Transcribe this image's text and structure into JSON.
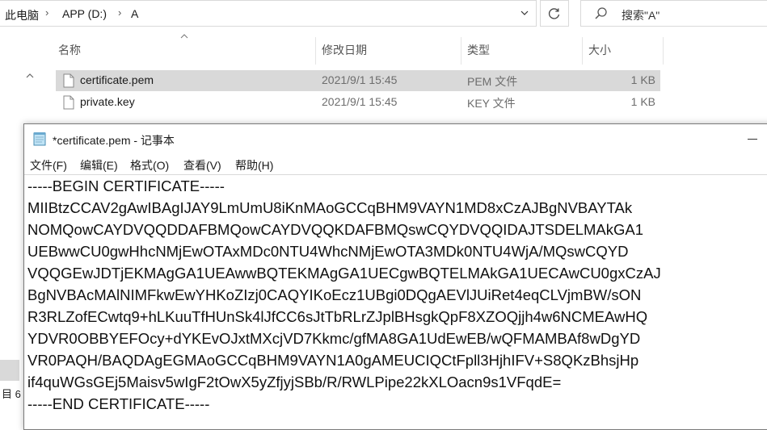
{
  "breadcrumb": {
    "items": [
      "此电脑",
      "APP (D:)",
      "A"
    ]
  },
  "search": {
    "placeholder": "搜索\"A\""
  },
  "columns": {
    "name": "名称",
    "modified": "修改日期",
    "type": "类型",
    "size": "大小"
  },
  "files": [
    {
      "name": "certificate.pem",
      "modified": "2021/9/1 15:45",
      "type": "PEM 文件",
      "size": "1 KB",
      "selected": true
    },
    {
      "name": "private.key",
      "modified": "2021/9/1 15:45",
      "type": "KEY 文件",
      "size": "1 KB",
      "selected": false
    }
  ],
  "nav": {
    "status_fragment": "目 6"
  },
  "notepad": {
    "title": "*certificate.pem - 记事本",
    "menu": [
      "文件(F)",
      "编辑(E)",
      "格式(O)",
      "查看(V)",
      "帮助(H)"
    ],
    "lines": [
      "-----BEGIN CERTIFICATE-----",
      "MIIBtzCCAV2gAwIBAgIJAY9LmUmU8iKnMAoGCCqBHM9VAYN1MD8xCzAJBgNVBAYTAk",
      "NOMQowCAYDVQQDDAFBMQowCAYDVQQKDAFBMQswCQYDVQQIDAJTSDELMAkGA1",
      "UEBwwCU0gwHhcNMjEwOTAxMDc0NTU4WhcNMjEwOTA3MDk0NTU4WjA/MQswCQYD",
      "VQQGEwJDTjEKMAgGA1UEAwwBQTEKMAgGA1UECgwBQTELMAkGA1UECAwCU0gxCzAJ",
      "BgNVBAcMAlNIMFkwEwYHKoZIzj0CAQYIKoEcz1UBgi0DQgAEVlJUiRet4eqCLVjmBW/sON",
      "R3RLZofECwtq9+hLKuuTfHUnSk4lJfCC6sJtTbRLrZJplBHsgkQpF8XZOQjjh4w6NCMEAwHQ",
      "YDVR0OBBYEFOcy+dYKEvOJxtMXcjVD7Kkmc/gfMA8GA1UdEwEB/wQFMAMBAf8wDgYD",
      "VR0PAQH/BAQDAgEGMAoGCCqBHM9VAYN1A0gAMEUCIQCtFpll3HjhIFV+S8QKzBhsjHp",
      "if4quWGsGEj5Maisv5wIgF2tOwX5yZfjyjSBb/R/RWLPipe22kXLOacn9s1VFqdE=",
      "-----END CERTIFICATE-----"
    ]
  }
}
